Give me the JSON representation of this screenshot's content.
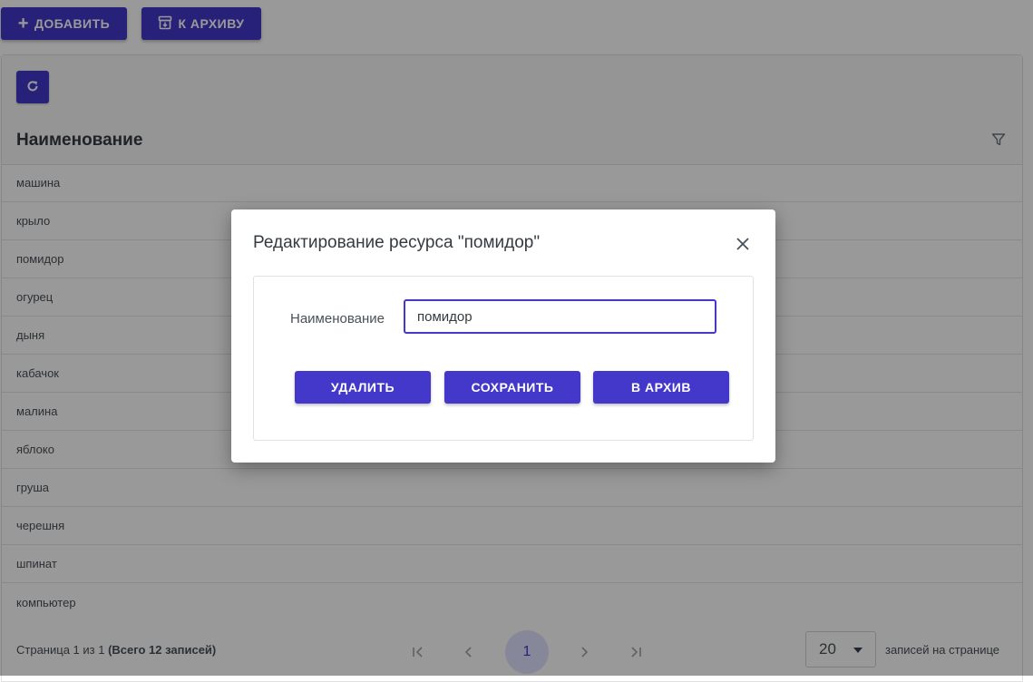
{
  "top_actions": {
    "add_label": "ДОБАВИТЬ",
    "archive_label": "К АРХИВУ"
  },
  "table": {
    "column_header": "Наименование",
    "rows": [
      "машина",
      "крыло",
      "помидор",
      "огурец",
      "дыня",
      "кабачок",
      "малина",
      "яблоко",
      "груша",
      "черешня",
      "шпинат",
      "компьютер"
    ]
  },
  "paginator": {
    "report_prefix": "Страница 1 из 1",
    "report_total": "(Всего 12 записей)",
    "current_page": "1",
    "rows_per_page": "20",
    "rows_per_page_label": "записей на странице"
  },
  "dialog": {
    "title": "Редактирование ресурса \"помидор\"",
    "field_label": "Наименование",
    "field_value": "помидор",
    "delete_label": "УДАЛИТЬ",
    "save_label": "СОХРАНИТЬ",
    "archive_label": "В АРХИВ"
  },
  "colors": {
    "primary": "#4338ca",
    "overlay": "rgba(0,0,0,0.4)"
  }
}
